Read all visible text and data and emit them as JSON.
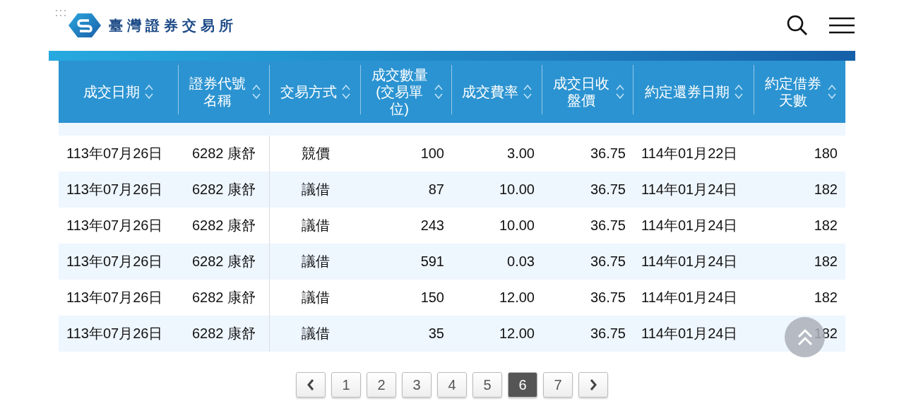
{
  "header": {
    "site_name": "臺灣證券交易所"
  },
  "table": {
    "columns": [
      "成交日期",
      "證券代號名稱",
      "交易方式",
      "成交數量(交易單位)",
      "成交費率",
      "成交日收盤價",
      "約定還券日期",
      "約定借券天數"
    ],
    "rows": [
      [
        "113年07月26日",
        "6282 康舒",
        "競價",
        "100",
        "3.00",
        "36.75",
        "114年01月22日",
        "180"
      ],
      [
        "113年07月26日",
        "6282 康舒",
        "議借",
        "87",
        "10.00",
        "36.75",
        "114年01月24日",
        "182"
      ],
      [
        "113年07月26日",
        "6282 康舒",
        "議借",
        "243",
        "10.00",
        "36.75",
        "114年01月24日",
        "182"
      ],
      [
        "113年07月26日",
        "6282 康舒",
        "議借",
        "591",
        "0.03",
        "36.75",
        "114年01月24日",
        "182"
      ],
      [
        "113年07月26日",
        "6282 康舒",
        "議借",
        "150",
        "12.00",
        "36.75",
        "114年01月24日",
        "182"
      ],
      [
        "113年07月26日",
        "6282 康舒",
        "議借",
        "35",
        "12.00",
        "36.75",
        "114年01月24日",
        "182"
      ]
    ]
  },
  "pagination": {
    "pages": [
      {
        "label": "1",
        "selected": false
      },
      {
        "label": "2",
        "selected": false
      },
      {
        "label": "3",
        "selected": false
      },
      {
        "label": "4",
        "selected": false
      },
      {
        "label": "5",
        "selected": false
      },
      {
        "label": "6",
        "selected": true
      },
      {
        "label": "7",
        "selected": false
      }
    ]
  }
}
